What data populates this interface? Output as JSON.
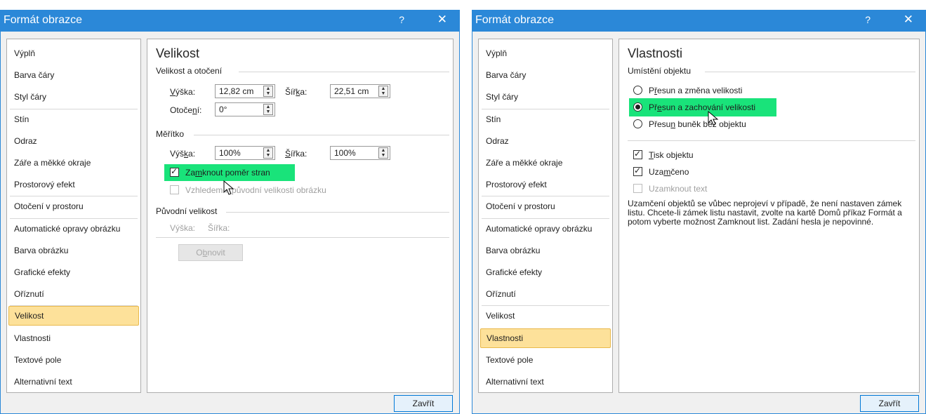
{
  "left": {
    "title": "Formát obrazce",
    "help": "?",
    "close_x": "✕",
    "nav": [
      "Výplň",
      "Barva čáry",
      "Styl čáry",
      "Stín",
      "Odraz",
      "Záře a měkké okraje",
      "Prostorový efekt",
      "Otočení v prostoru",
      "Automatické opravy obrázku",
      "Barva obrázku",
      "Grafické efekty",
      "Oříznutí",
      "Velikost",
      "Vlastnosti",
      "Textové pole",
      "Alternativní text"
    ],
    "selected_index": 12,
    "heading": "Velikost",
    "group1": "Velikost a otočení",
    "height_label": "Výška:",
    "height_value": "12,82 cm",
    "width_label": "Šířka:",
    "width_value": "22,51 cm",
    "rotation_label": "Otočení:",
    "rotation_value": "0°",
    "group2": "Měřítko",
    "scale_height_label": "Výška:",
    "scale_height_value": "100%",
    "scale_width_label": "Šířka:",
    "scale_width_value": "100%",
    "lock_ratio": "Zamknout poměr stran",
    "relative_original": "Vzhledem k původní velikosti obrázku",
    "group3": "Původní velikost",
    "orig_height": "Výška:",
    "orig_width": "Šířka:",
    "reset": "Obnovit",
    "close_button": "Zavřít"
  },
  "right": {
    "title": "Formát obrazce",
    "help": "?",
    "close_x": "✕",
    "nav": [
      "Výplň",
      "Barva čáry",
      "Styl čáry",
      "Stín",
      "Odraz",
      "Záře a měkké okraje",
      "Prostorový efekt",
      "Otočení v prostoru",
      "Automatické opravy obrázku",
      "Barva obrázku",
      "Grafické efekty",
      "Oříznutí",
      "Velikost",
      "Vlastnosti",
      "Textové pole",
      "Alternativní text"
    ],
    "selected_index": 13,
    "heading": "Vlastnosti",
    "group1": "Umístění objektu",
    "radio1": "Přesun a změna velikosti",
    "radio2": "Přesun a zachování velikosti",
    "radio3": "Přesun buněk bez objektu",
    "print_object": "Tisk objektu",
    "locked": "Uzamčeno",
    "lock_text": "Uzamknout text",
    "info": "Uzamčení objektů se vůbec neprojeví v případě, že není nastaven zámek listu. Chcete-li zámek listu nastavit, zvolte na kartě Domů příkaz Formát a potom vyberte možnost Zamknout list. Zadání hesla je nepovinné.",
    "close_button": "Zavřít"
  },
  "colors": {
    "title_bar": "#2b88d8",
    "highlight": "#19e37a",
    "selected_nav": "#fde19a"
  },
  "icons": [
    "close-icon",
    "help-icon",
    "spin-up-icon",
    "spin-down-icon",
    "mouse-cursor-icon",
    "checkbox-checked-icon",
    "radio-selected-icon"
  ]
}
